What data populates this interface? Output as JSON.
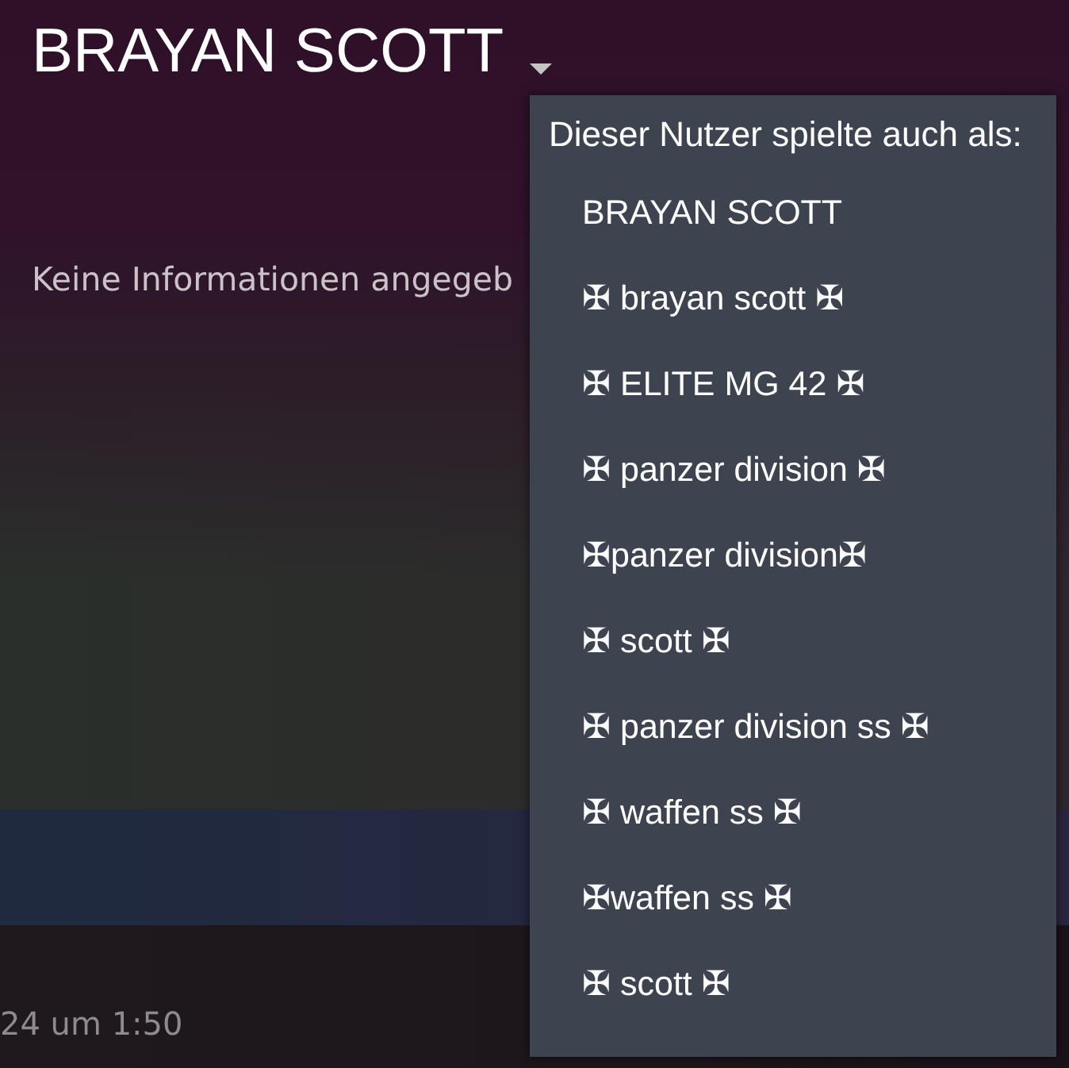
{
  "profile": {
    "name": "BRAYAN SCOTT",
    "summary": "Keine Informationen angegeb"
  },
  "alias_dropdown": {
    "expanded": true,
    "heading": "Dieser Nutzer spielte auch als:",
    "aliases": [
      "BRAYAN SCOTT",
      "✠ brayan scott ✠",
      "✠ ELITE MG 42 ✠",
      "✠ panzer division ✠",
      "✠panzer division✠",
      "✠ scott ✠",
      "✠ panzer division ss ✠",
      "✠ waffen ss ✠",
      "✠waffen ss ✠",
      "✠ scott ✠"
    ]
  },
  "footer": {
    "timestamp": "24 um 1:50"
  }
}
